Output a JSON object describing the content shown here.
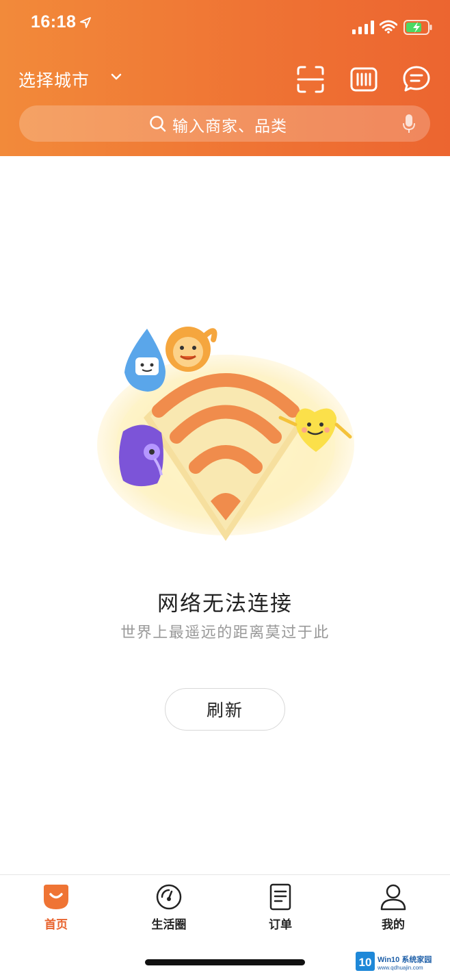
{
  "status_bar": {
    "time": "16:18"
  },
  "header": {
    "city_label": "选择城市",
    "search_placeholder": "输入商家、品类",
    "icons": [
      "location-arrow-icon",
      "signal-icon",
      "wifi-icon",
      "battery-icon",
      "chevron-down-icon",
      "scan-icon",
      "barcode-icon",
      "message-icon",
      "search-icon",
      "microphone-icon"
    ]
  },
  "error": {
    "title": "网络无法连接",
    "subtitle": "世界上最遥远的距离莫过于此",
    "refresh_label": "刷新"
  },
  "tabbar": {
    "items": [
      {
        "label": "首页",
        "icon": "home-icon",
        "active": true
      },
      {
        "label": "生活圈",
        "icon": "life-circle-icon",
        "active": false
      },
      {
        "label": "订单",
        "icon": "order-icon",
        "active": false
      },
      {
        "label": "我的",
        "icon": "profile-icon",
        "active": false
      }
    ]
  },
  "watermark": {
    "number": "10",
    "brand": "Win10 系统家园",
    "url": "www.qdhuajin.com"
  },
  "colors": {
    "accent": "#ef7434",
    "active_tab": "#e8632d"
  }
}
